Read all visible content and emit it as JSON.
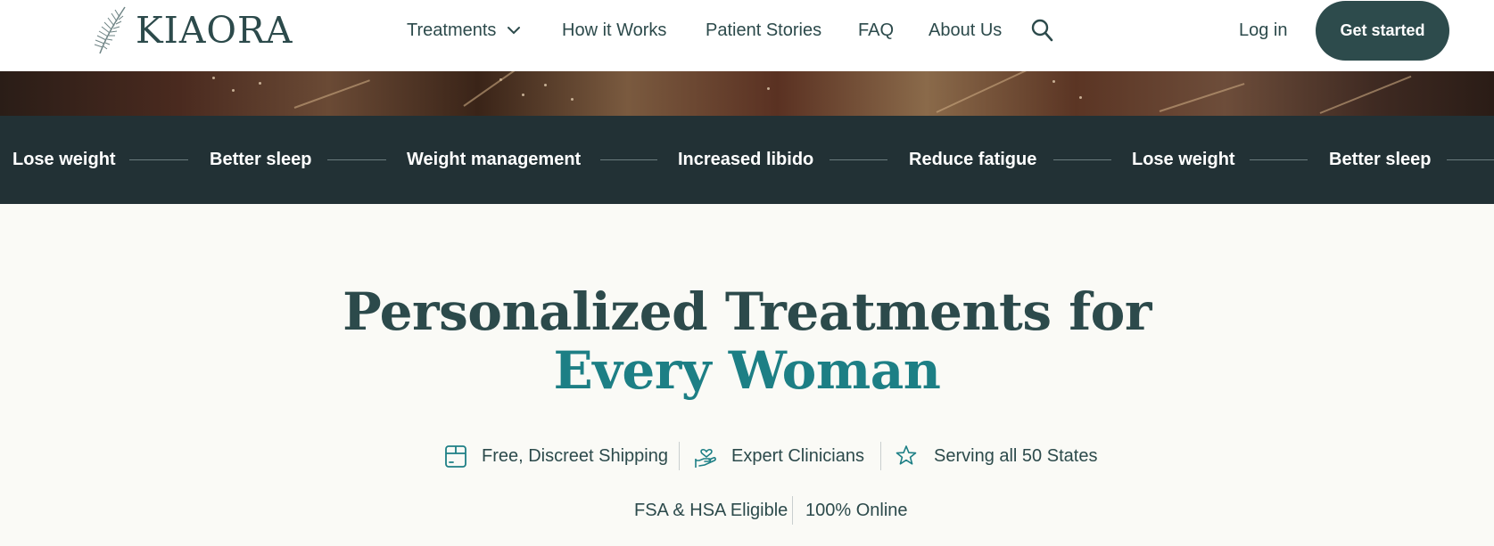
{
  "brand": {
    "name": "KIAORA"
  },
  "nav": {
    "items": [
      {
        "label": "Treatments",
        "has_dropdown": true
      },
      {
        "label": "How it Works"
      },
      {
        "label": "Patient Stories"
      },
      {
        "label": "FAQ"
      },
      {
        "label": "About Us"
      }
    ],
    "search_icon": "search-icon",
    "login_label": "Log in",
    "cta_label": "Get started"
  },
  "marquee": {
    "items": [
      "Lose weight",
      "Better sleep",
      "Weight management",
      "Increased libido",
      "Reduce fatigue",
      "Lose weight",
      "Better sleep"
    ]
  },
  "hero": {
    "headline_line1": "Personalized Treatments for",
    "headline_line2": "Every Woman"
  },
  "features": [
    {
      "icon": "package-icon",
      "label": "Free, Discreet Shipping"
    },
    {
      "icon": "hand-heart-icon",
      "label": "Expert Clinicians"
    },
    {
      "icon": "star-icon",
      "label": "Serving all 50 States"
    }
  ],
  "eligibility": [
    "FSA & HSA Eligible",
    "100% Online"
  ],
  "colors": {
    "brand_dark": "#2d4b4c",
    "accent_teal": "#1d7f85",
    "marquee_bg": "#223135",
    "page_bg": "#fafaf6"
  }
}
